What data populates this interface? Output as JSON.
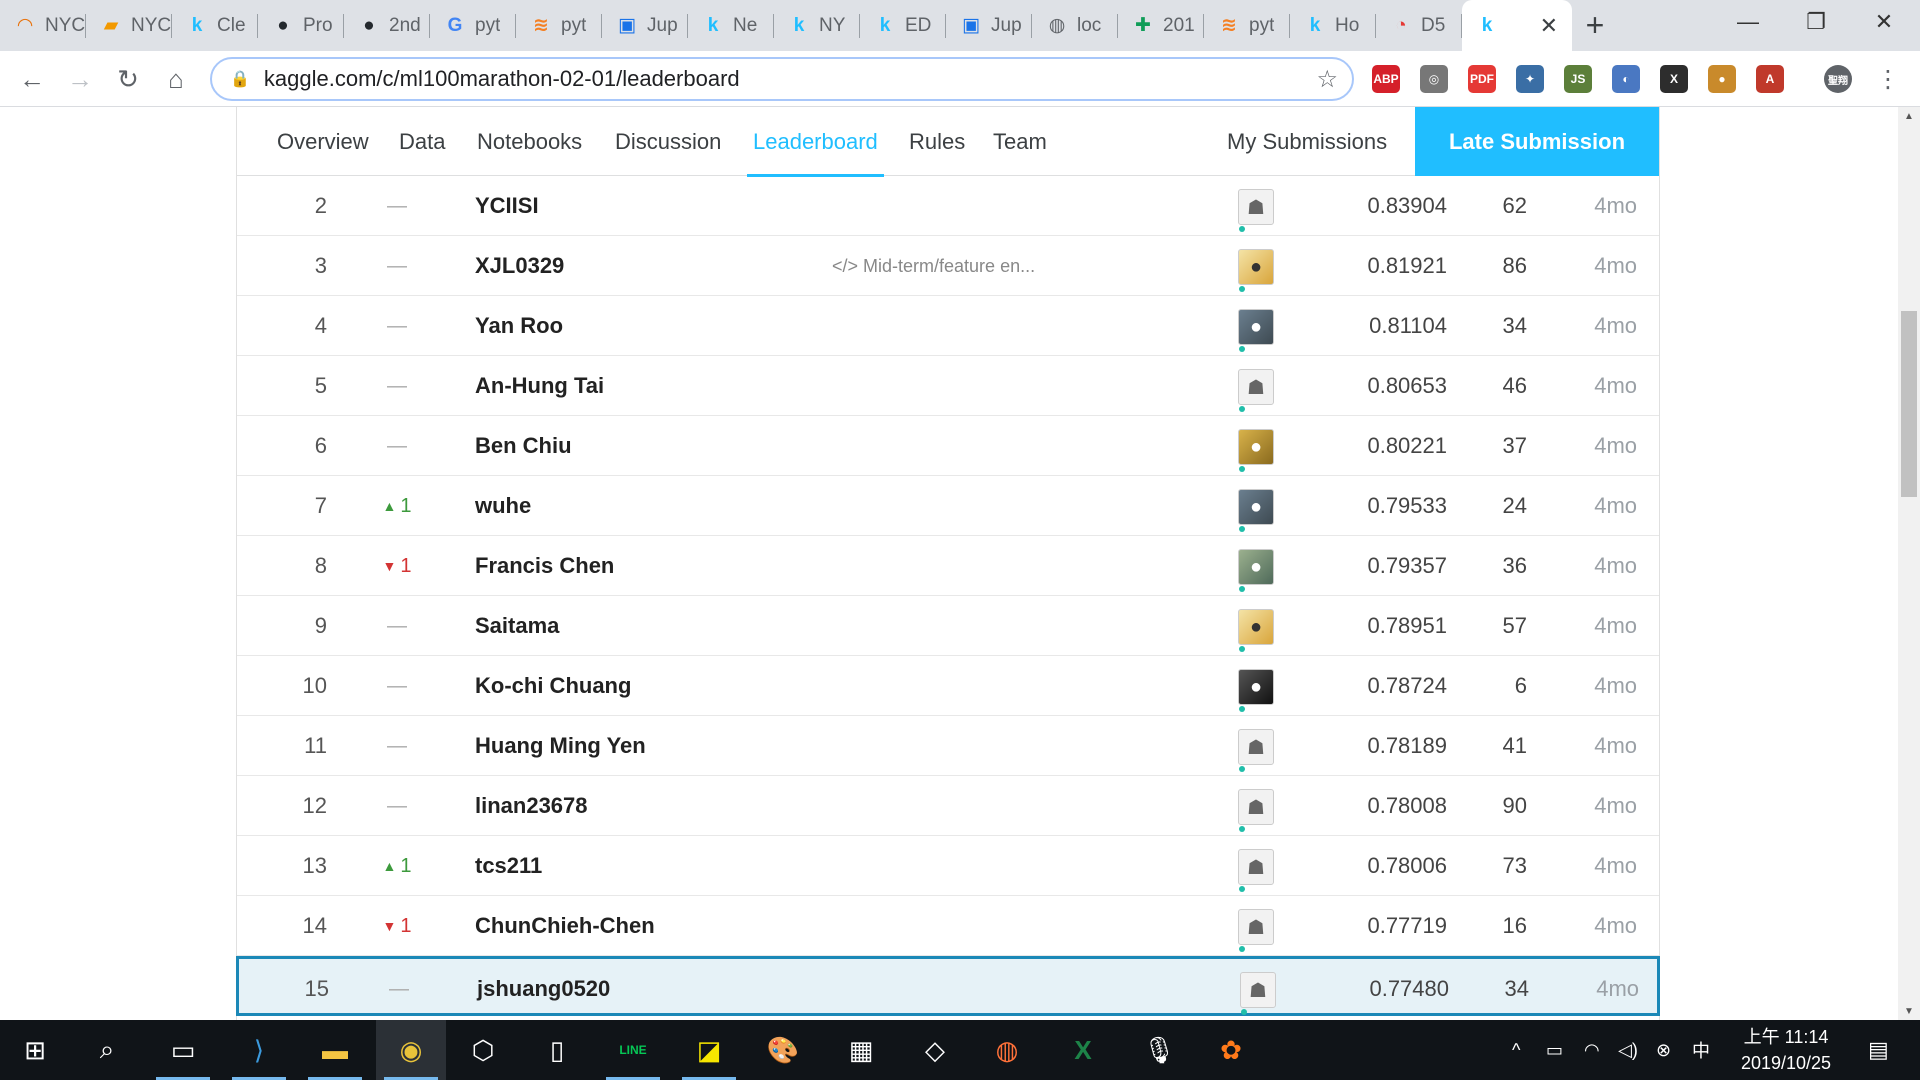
{
  "browser": {
    "tabs": [
      {
        "title": "NYC",
        "icon": "loading-ring-icon",
        "color": "#e8710a"
      },
      {
        "title": "NYC",
        "icon": "notebook-icon",
        "color": "#f29900"
      },
      {
        "title": "Cle",
        "icon": "kaggle-k-icon",
        "color": "#20beff"
      },
      {
        "title": "Pro",
        "icon": "github-icon",
        "color": "#24292e"
      },
      {
        "title": "2nd",
        "icon": "github-icon",
        "color": "#24292e"
      },
      {
        "title": "pyt",
        "icon": "google-g-icon",
        "color": "#4285f4"
      },
      {
        "title": "pyt",
        "icon": "stackoverflow-icon",
        "color": "#f48024"
      },
      {
        "title": "Jup",
        "icon": "jupyter-nb-icon",
        "color": "#1a73e8"
      },
      {
        "title": "Ne",
        "icon": "kaggle-k-icon",
        "color": "#20beff"
      },
      {
        "title": "NY",
        "icon": "kaggle-k-icon",
        "color": "#20beff"
      },
      {
        "title": "ED",
        "icon": "kaggle-k-icon",
        "color": "#20beff"
      },
      {
        "title": "Jup",
        "icon": "jupyter-nb-icon",
        "color": "#1a73e8"
      },
      {
        "title": "loc",
        "icon": "globe-icon",
        "color": "#5f6368"
      },
      {
        "title": "201",
        "icon": "sheets-plus-icon",
        "color": "#0f9d58"
      },
      {
        "title": "pyt",
        "icon": "stackoverflow-icon",
        "color": "#f48024"
      },
      {
        "title": "Ho",
        "icon": "kaggle-k-icon",
        "color": "#20beff"
      },
      {
        "title": "D5",
        "icon": "cupoy-icon",
        "color": "#e53935"
      }
    ],
    "active_tab": {
      "icon": "kaggle-k-icon",
      "color": "#20beff",
      "close": "✕"
    },
    "new_tab": "+",
    "window_controls": {
      "minimize": "—",
      "restore": "❐",
      "close": "✕"
    },
    "url": "kaggle.com/c/ml100marathon-02-01/leaderboard",
    "extensions": [
      {
        "name": "adblock-plus-icon",
        "label": "ABP",
        "color": "#d5202a"
      },
      {
        "name": "extension-globe-icon",
        "label": "◎",
        "color": "#777777"
      },
      {
        "name": "pdf-icon",
        "label": "PDF",
        "color": "#e53935"
      },
      {
        "name": "telescope-icon",
        "label": "✦",
        "color": "#3a6ea5"
      },
      {
        "name": "nodejs-icon",
        "label": "JS",
        "color": "#5c7f3a"
      },
      {
        "name": "circle-app-icon",
        "label": "◐",
        "color": "#4a78c2"
      },
      {
        "name": "x-app-icon",
        "label": "X",
        "color": "#2d2d2d"
      },
      {
        "name": "cookie-icon",
        "label": "●",
        "color": "#c98a2b"
      },
      {
        "name": "acrobat-icon",
        "label": "A",
        "color": "#c0392b"
      },
      {
        "name": "profile-avatar-icon",
        "label": "聖翔",
        "color": "#5f6368"
      }
    ]
  },
  "subnav": {
    "tabs": [
      "Overview",
      "Data",
      "Notebooks",
      "Discussion",
      "Leaderboard",
      "Rules",
      "Team"
    ],
    "active": "Leaderboard",
    "my_submissions": "My Submissions",
    "late_submission": "Late Submission"
  },
  "leaderboard": [
    {
      "rank": "2",
      "delta": "—",
      "dir": "none",
      "team": "YCIISI",
      "kernel": "",
      "avatar": "default",
      "score": "0.83904",
      "entries": "62",
      "last": "4mo"
    },
    {
      "rank": "3",
      "delta": "—",
      "dir": "none",
      "team": "XJL0329",
      "kernel": "</> Mid-term/feature en...",
      "avatar": "photo4",
      "score": "0.81921",
      "entries": "86",
      "last": "4mo"
    },
    {
      "rank": "4",
      "delta": "—",
      "dir": "none",
      "team": "Yan Roo",
      "kernel": "",
      "avatar": "photo",
      "score": "0.81104",
      "entries": "34",
      "last": "4mo"
    },
    {
      "rank": "5",
      "delta": "—",
      "dir": "none",
      "team": "An-Hung Tai",
      "kernel": "",
      "avatar": "default",
      "score": "0.80653",
      "entries": "46",
      "last": "4mo"
    },
    {
      "rank": "6",
      "delta": "—",
      "dir": "none",
      "team": "Ben Chiu",
      "kernel": "",
      "avatar": "photo2",
      "score": "0.80221",
      "entries": "37",
      "last": "4mo"
    },
    {
      "rank": "7",
      "delta": "1",
      "dir": "up",
      "team": "wuhe",
      "kernel": "",
      "avatar": "photo",
      "score": "0.79533",
      "entries": "24",
      "last": "4mo"
    },
    {
      "rank": "8",
      "delta": "1",
      "dir": "down",
      "team": "Francis Chen",
      "kernel": "",
      "avatar": "photo3",
      "score": "0.79357",
      "entries": "36",
      "last": "4mo"
    },
    {
      "rank": "9",
      "delta": "—",
      "dir": "none",
      "team": "Saitama",
      "kernel": "",
      "avatar": "photo4",
      "score": "0.78951",
      "entries": "57",
      "last": "4mo"
    },
    {
      "rank": "10",
      "delta": "—",
      "dir": "none",
      "team": "Ko-chi Chuang",
      "kernel": "",
      "avatar": "photo5",
      "score": "0.78724",
      "entries": "6",
      "last": "4mo"
    },
    {
      "rank": "11",
      "delta": "—",
      "dir": "none",
      "team": "Huang Ming Yen",
      "kernel": "",
      "avatar": "default",
      "score": "0.78189",
      "entries": "41",
      "last": "4mo"
    },
    {
      "rank": "12",
      "delta": "—",
      "dir": "none",
      "team": "linan23678",
      "kernel": "",
      "avatar": "default",
      "score": "0.78008",
      "entries": "90",
      "last": "4mo"
    },
    {
      "rank": "13",
      "delta": "1",
      "dir": "up",
      "team": "tcs211",
      "kernel": "",
      "avatar": "default",
      "score": "0.78006",
      "entries": "73",
      "last": "4mo"
    },
    {
      "rank": "14",
      "delta": "1",
      "dir": "down",
      "team": "ChunChieh-Chen",
      "kernel": "",
      "avatar": "default",
      "score": "0.77719",
      "entries": "16",
      "last": "4mo"
    },
    {
      "rank": "15",
      "delta": "—",
      "dir": "none",
      "team": "jshuang0520",
      "kernel": "",
      "avatar": "default",
      "score": "0.77480",
      "entries": "34",
      "last": "4mo",
      "highlight": true
    }
  ],
  "taskbar": {
    "apps": [
      {
        "name": "start-windows-icon",
        "glyph": "⊞"
      },
      {
        "name": "search-icon",
        "glyph": "⌕"
      },
      {
        "name": "terminal-icon",
        "glyph": "▭"
      },
      {
        "name": "vscode-icon",
        "glyph": "⟩"
      },
      {
        "name": "file-explorer-icon",
        "glyph": "▬"
      },
      {
        "name": "chrome-icon",
        "glyph": "◉"
      },
      {
        "name": "3d-box-icon",
        "glyph": "⬡"
      },
      {
        "name": "blank-file-icon",
        "glyph": "▯"
      },
      {
        "name": "line-app-icon",
        "glyph": "LINE"
      },
      {
        "name": "sticky-notes-icon",
        "glyph": "◪"
      },
      {
        "name": "paint-palette-icon",
        "glyph": "🎨"
      },
      {
        "name": "calculator-icon",
        "glyph": "▦"
      },
      {
        "name": "notes-tablet-icon",
        "glyph": "◇"
      },
      {
        "name": "firefox-icon",
        "glyph": "◍"
      },
      {
        "name": "excel-icon",
        "glyph": "X"
      },
      {
        "name": "voice-recorder-icon",
        "glyph": "🎙"
      },
      {
        "name": "orange-app-icon",
        "glyph": "✿"
      }
    ],
    "tray": {
      "chevron": "^",
      "battery": "▭",
      "wifi": "◠",
      "volume": "◁)",
      "close_circle": "⊗",
      "ime": "中"
    },
    "clock": {
      "time": "上午 11:14",
      "date": "2019/10/25"
    },
    "notifications": "▤"
  }
}
